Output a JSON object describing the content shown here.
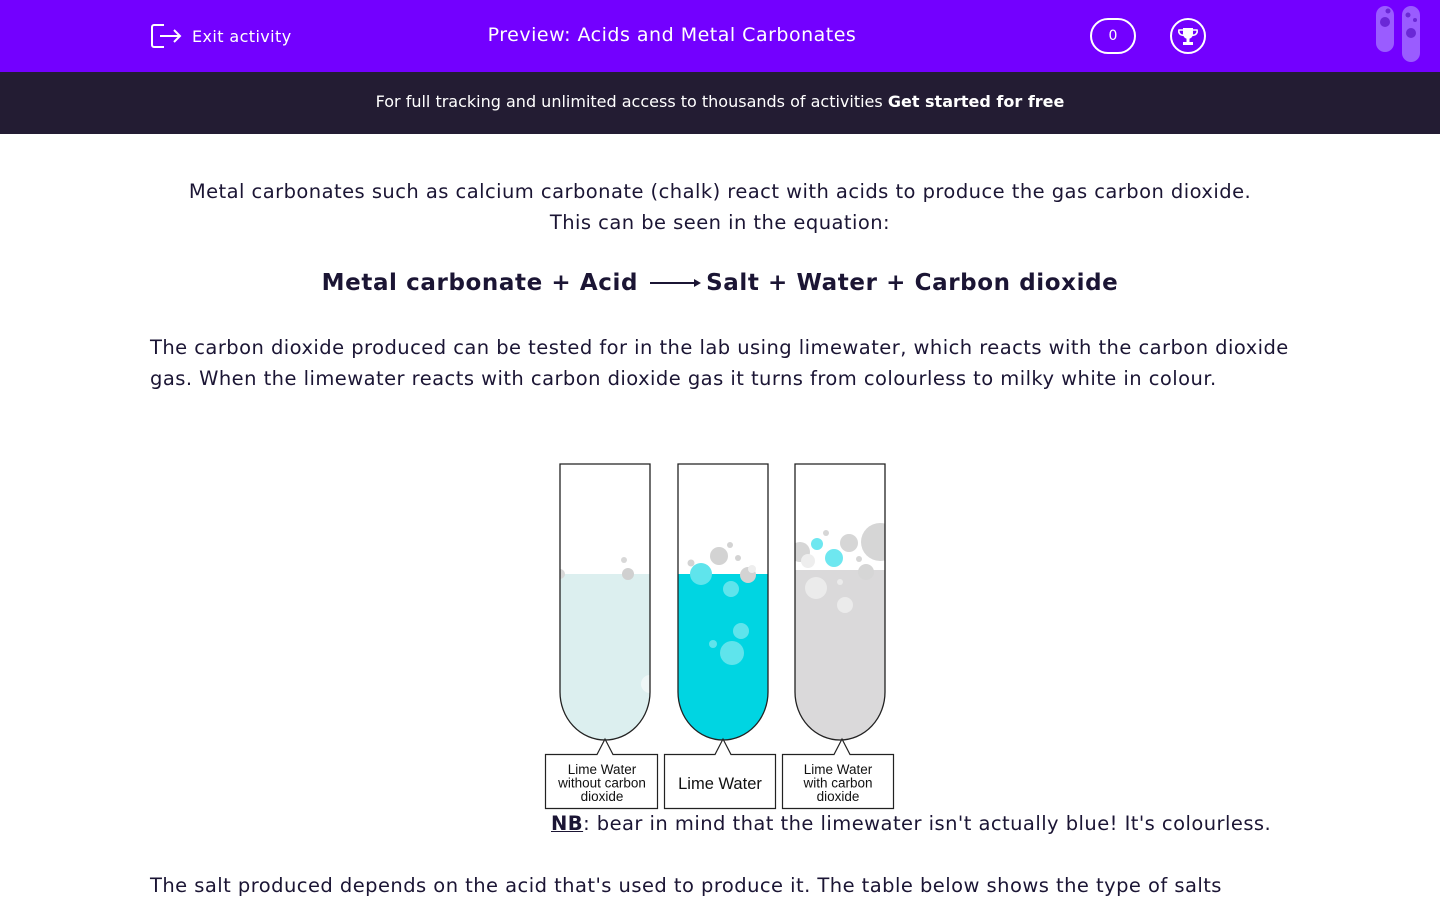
{
  "header": {
    "exit_label": "Exit activity",
    "title": "Preview: Acids and Metal Carbonates",
    "score": "0",
    "accent": "#7300ff"
  },
  "banner": {
    "text": "For full tracking and unlimited access to thousands of activities ",
    "cta": "Get started for free"
  },
  "content": {
    "intro_line1": "Metal carbonates such as calcium carbonate (chalk) react with acids to produce the gas carbon dioxide.",
    "intro_line2": "This can be seen in the equation:",
    "equation_left": "Metal carbonate + Acid",
    "equation_right": "Salt + Water + Carbon dioxide",
    "paragraph": "The carbon dioxide produced can be tested for in the lab using limewater, which reacts with the carbon dioxide gas. When the limewater reacts with carbon dioxide gas it turns from colourless to milky white in colour.",
    "figure_labels": {
      "tube1": [
        "Lime Water",
        "without carbon",
        "dioxide"
      ],
      "tube2": "Lime Water",
      "tube3": [
        "Lime Water",
        "with carbon",
        "dioxide"
      ]
    },
    "nb_label": "NB",
    "nb_text": ": bear in mind that the limewater isn't actually blue! It's colourless.",
    "salt_text": "The salt produced depends on the acid that's used to produce it. The table below shows the type of salts"
  },
  "colors": {
    "tube1_liquid": "#dcefef",
    "tube2_liquid": "#00d5e2",
    "tube3_liquid": "#dad9da"
  }
}
